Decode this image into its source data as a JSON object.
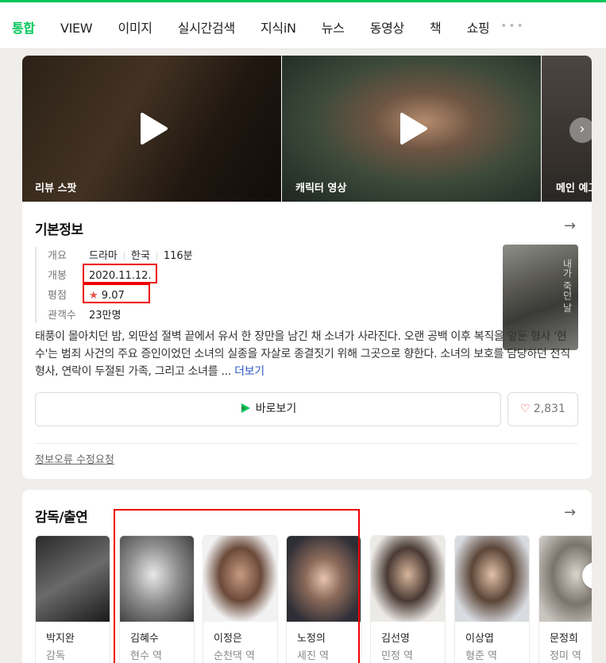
{
  "nav": {
    "tabs": [
      "통합",
      "VIEW",
      "이미지",
      "실시간검색",
      "지식iN",
      "뉴스",
      "동영상",
      "책",
      "쇼핑"
    ],
    "active_tab": "통합",
    "more": "•••"
  },
  "videos": [
    {
      "label": "리뷰 스팟"
    },
    {
      "label": "캐릭터 영상"
    },
    {
      "label": "메인 예고"
    }
  ],
  "basic_info": {
    "title": "기본정보",
    "rows": {
      "overview_key": "개요",
      "genre": "드라마",
      "country": "한국",
      "runtime": "116분",
      "release_key": "개봉",
      "release_date": "2020.11.12.",
      "rating_key": "평점",
      "rating_star": "★",
      "rating": "9.07",
      "audience_key": "관객수",
      "audience": "23만명"
    },
    "poster_text": "내가 죽던 날",
    "synopsis": "태풍이 몰아치던 밤, 외딴섬 절벽 끝에서 유서 한 장만을 남긴 채 소녀가 사라진다. 오랜 공백 이후 복직을 앞둔 형사 '현수'는 범죄 사건의 주요 증인이었던 소녀의 실종을 자살로 종결짓기 위해 그곳으로 향한다. 소녀의 보호를 담당하던 전직 형사, 연락이 두절된 가족, 그리고 소녀를 ...",
    "more_label": "더보기",
    "watch_label": "바로보기",
    "like_count": "2,831",
    "report_label": "정보오류 수정요청"
  },
  "cast": {
    "title": "감독/출연",
    "people": [
      {
        "name": "박지완",
        "role": "감독"
      },
      {
        "name": "김혜수",
        "role": "현수 역"
      },
      {
        "name": "이정은",
        "role": "순천댁 역"
      },
      {
        "name": "노정의",
        "role": "세진 역"
      },
      {
        "name": "김선영",
        "role": "민정 역"
      },
      {
        "name": "이상엽",
        "role": "형준 역"
      },
      {
        "name": "문정희",
        "role": "정미 역"
      }
    ]
  },
  "colors": {
    "accent": "#03c75a",
    "highlight_box": "#e00000",
    "rating_star": "#e8524a",
    "link": "#2d57c5"
  },
  "icons": {
    "play": "play-icon",
    "next": "chevron-right-icon",
    "arrow": "arrow-right-icon",
    "heart": "heart-icon",
    "watch": "play-triangle-icon"
  }
}
